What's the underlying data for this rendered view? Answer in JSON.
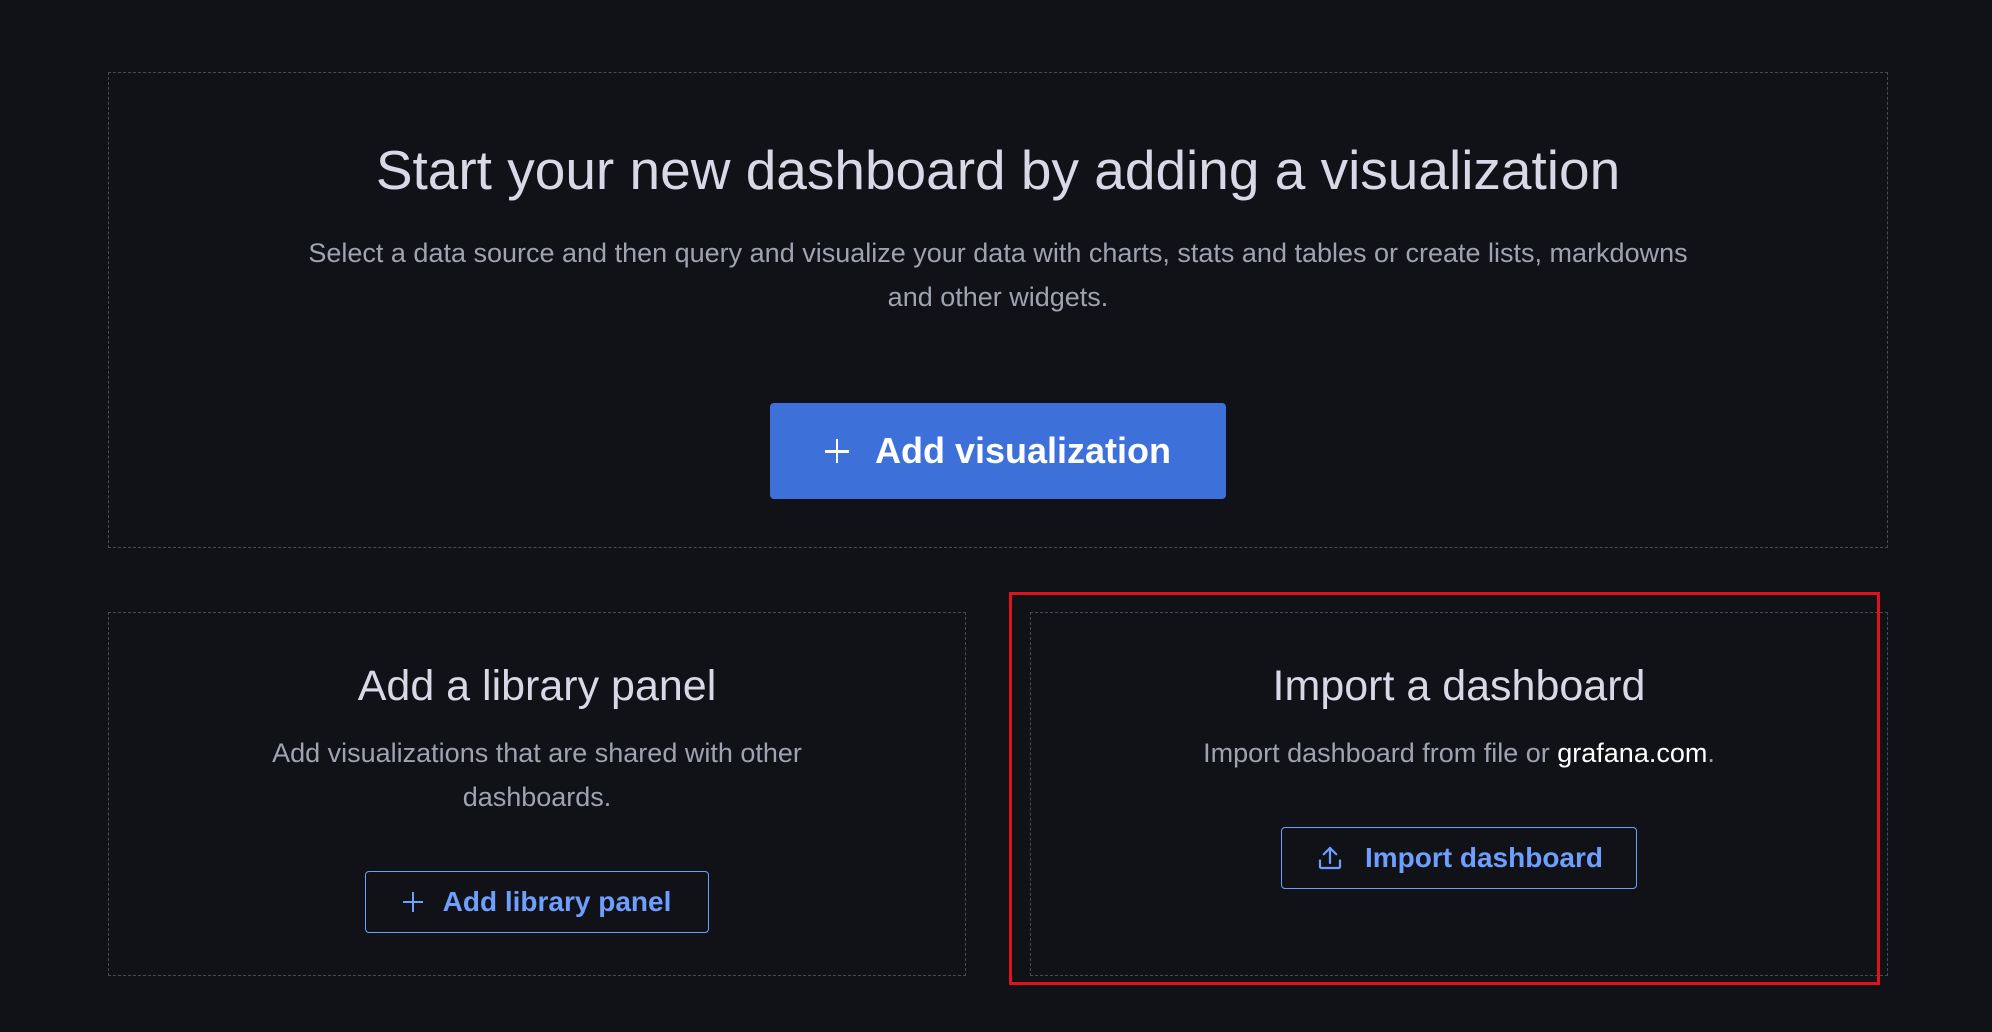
{
  "main": {
    "title": "Start your new dashboard by adding a visualization",
    "description": "Select a data source and then query and visualize your data with charts, stats and tables or create lists, markdowns and other widgets.",
    "button_label": "Add visualization",
    "button_icon": "plus-icon"
  },
  "library": {
    "title": "Add a library panel",
    "description": "Add visualizations that are shared with other dashboards.",
    "button_label": "Add library panel",
    "button_icon": "plus-icon"
  },
  "import": {
    "title": "Import a dashboard",
    "description_prefix": "Import dashboard from file or ",
    "link_text": "grafana.com",
    "description_suffix": ".",
    "button_label": "Import dashboard",
    "button_icon": "upload-icon"
  },
  "colors": {
    "background": "#111217",
    "primary": "#3d71d9",
    "secondary_accent": "#6e9fff",
    "highlight": "#e3111b"
  }
}
